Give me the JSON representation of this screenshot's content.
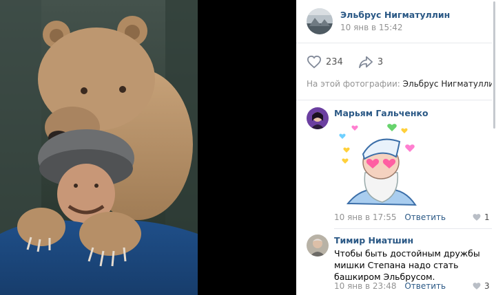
{
  "post": {
    "author": "Эльбрус Нигматуллин",
    "date": "10 янв в 15:42",
    "likes": "234",
    "shares": "3",
    "tagged_label": "На этой фотографии:",
    "tagged_person": "Эльбрус Нигматуллин"
  },
  "comments": [
    {
      "author": "Марьям Гальченко",
      "content": "",
      "date": "10 янв в 17:55",
      "reply": "Ответить",
      "likes": "1"
    },
    {
      "author": "Тимир Ниатшин",
      "content": "Чтобы быть достойным дружбы мишки Степана надо стать башкиром Эльбрусом.",
      "date": "10 янв в 23:48",
      "reply": "Ответить",
      "likes": "3"
    }
  ],
  "colors": {
    "link": "#2a5885",
    "muted": "#939393",
    "photo_bg": "#000000"
  },
  "icons": [
    "heart-icon",
    "share-icon"
  ]
}
